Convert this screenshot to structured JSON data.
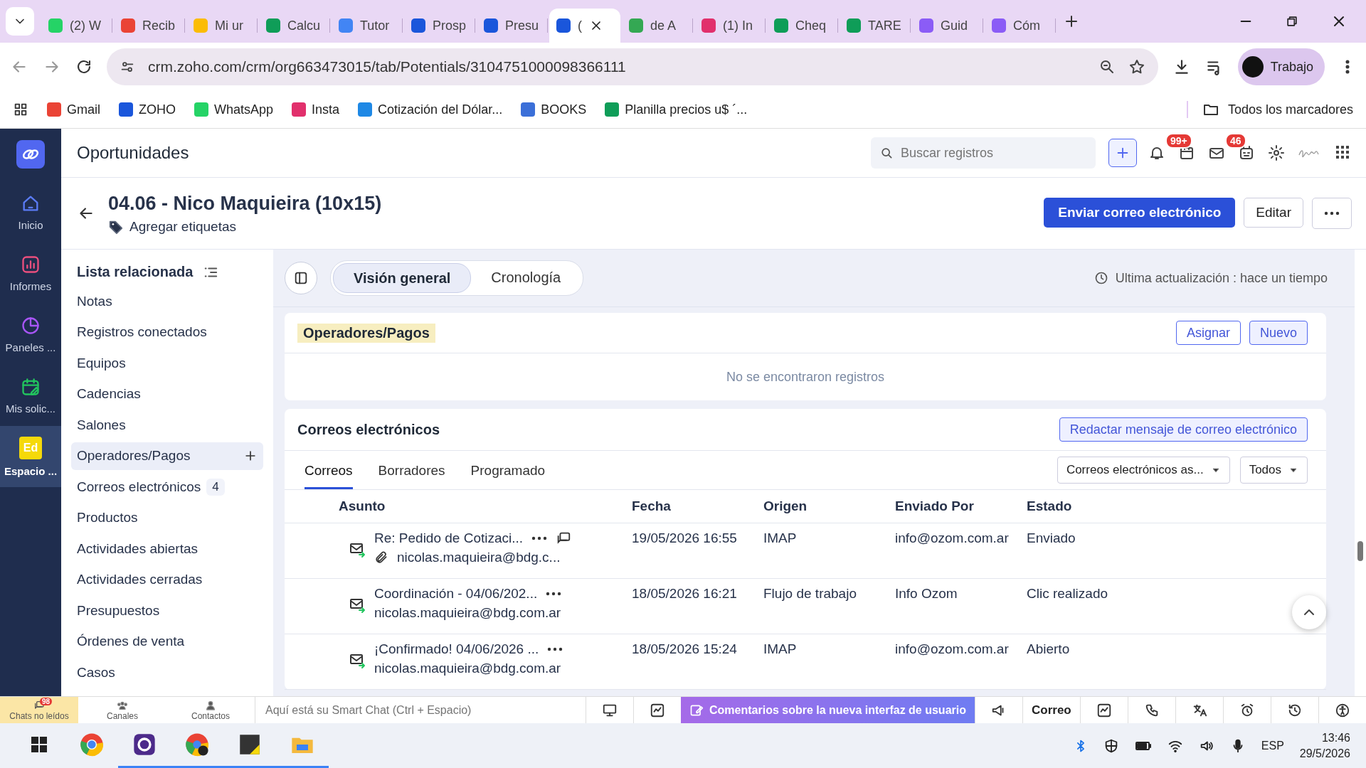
{
  "browser": {
    "tabs": [
      {
        "title": "(2) W",
        "color": "#25d366",
        "selected": false
      },
      {
        "title": "Recib",
        "color": "#ea4335",
        "selected": false
      },
      {
        "title": "Mi ur",
        "color": "#fbbc04",
        "selected": false
      },
      {
        "title": "Calcu",
        "color": "#0f9d58",
        "selected": false
      },
      {
        "title": "Tutor",
        "color": "#4285f4",
        "selected": false
      },
      {
        "title": "Prosp",
        "color": "#1a56db",
        "selected": false
      },
      {
        "title": "Presu",
        "color": "#1a56db",
        "selected": false
      },
      {
        "title": "(",
        "color": "#1a56db",
        "selected": true
      },
      {
        "title": "de A",
        "color": "#34a853",
        "selected": false
      },
      {
        "title": "(1) In",
        "color": "#e1306c",
        "selected": false
      },
      {
        "title": "Cheq",
        "color": "#0f9d58",
        "selected": false
      },
      {
        "title": "TARE",
        "color": "#0f9d58",
        "selected": false
      },
      {
        "title": "Guid",
        "color": "#8b5cf6",
        "selected": false
      },
      {
        "title": "Cóm",
        "color": "#8b5cf6",
        "selected": false
      }
    ],
    "url": "crm.zoho.com/crm/org663473015/tab/Potentials/3104751000098366111",
    "profile": "Trabajo",
    "bookmarks": [
      {
        "label": "Gmail",
        "color": "#ea4335"
      },
      {
        "label": "ZOHO",
        "color": "#1a56db"
      },
      {
        "label": "WhatsApp",
        "color": "#25d366"
      },
      {
        "label": "Insta",
        "color": "#e1306c"
      },
      {
        "label": "Cotización del Dólar...",
        "color": "#1e88e5"
      },
      {
        "label": "BOOKS",
        "color": "#3b6fd8"
      },
      {
        "label": "Planilla precios u$ ´...",
        "color": "#0f9d58"
      }
    ],
    "all_bookmarks": "Todos los marcadores"
  },
  "app_nav": [
    {
      "label": "Inicio",
      "color": "#5b7cf7",
      "selected": false
    },
    {
      "label": "Informes",
      "color": "#ec4f7e",
      "selected": false
    },
    {
      "label": "Paneles ...",
      "color": "#a855f7",
      "selected": false
    },
    {
      "label": "Mis solic...",
      "color": "#22c55e",
      "selected": false
    },
    {
      "label": "Espacio ...",
      "color": "#f5d90a",
      "badge": "Ed",
      "selected": true
    }
  ],
  "header": {
    "title": "Oportunidades",
    "search_placeholder": "Buscar registros",
    "notifications_badge": "99+",
    "mail_badge": "46"
  },
  "record": {
    "title": "04.06 - Nico Maquieira (10x15)",
    "tags_link": "Agregar etiquetas",
    "buttons": [
      "Enviar correo electrónico",
      "Editar"
    ]
  },
  "related_list": {
    "title": "Lista relacionada",
    "items": [
      {
        "label": "Notas",
        "selected": false
      },
      {
        "label": "Registros conectados",
        "selected": false
      },
      {
        "label": "Equipos",
        "selected": false
      },
      {
        "label": "Cadencias",
        "selected": false
      },
      {
        "label": "Salones",
        "selected": false
      },
      {
        "label": "Operadores/Pagos",
        "selected": true
      },
      {
        "label": "Correos electrónicos",
        "count": "4",
        "selected": false
      },
      {
        "label": "Productos",
        "selected": false
      },
      {
        "label": "Actividades abiertas",
        "selected": false
      },
      {
        "label": "Actividades cerradas",
        "selected": false
      },
      {
        "label": "Presupuestos",
        "selected": false
      },
      {
        "label": "Órdenes de venta",
        "selected": false
      },
      {
        "label": "Casos",
        "selected": false
      }
    ]
  },
  "view_tabs": [
    {
      "label": "Visión general",
      "selected": true
    },
    {
      "label": "Cronología",
      "selected": false
    }
  ],
  "last_update": "Ultima actualización : hace un tiempo",
  "operadores": {
    "title": "Operadores/Pagos",
    "buttons": [
      "Asignar",
      "Nuevo"
    ],
    "empty": "No se encontraron registros"
  },
  "emails": {
    "title": "Correos electrónicos",
    "compose": "Redactar mensaje de correo electrónico",
    "tabs": [
      {
        "label": "Correos",
        "selected": true
      },
      {
        "label": "Borradores",
        "selected": false
      },
      {
        "label": "Programado",
        "selected": false
      }
    ],
    "filters": [
      "Correos electrónicos as...",
      "Todos"
    ],
    "columns": [
      "Asunto",
      "Fecha",
      "Origen",
      "Enviado Por",
      "Estado"
    ],
    "rows": [
      {
        "subject": "Re: Pedido de Cotizaci...",
        "thread": true,
        "attachment": true,
        "to": "nicolas.maquieira@bdg.c...",
        "date": "19/05/2026 16:55",
        "origin": "IMAP",
        "sender": "info@ozom.com.ar",
        "status": "Enviado"
      },
      {
        "subject": "Coordinación - 04/06/202...",
        "thread": false,
        "attachment": false,
        "to": "nicolas.maquieira@bdg.com.ar",
        "date": "18/05/2026 16:21",
        "origin": "Flujo de trabajo",
        "sender": "Info Ozom",
        "status": "Clic realizado"
      },
      {
        "subject": "¡Confirmado! 04/06/2026 ...",
        "thread": false,
        "attachment": false,
        "to": "nicolas.maquieira@bdg.com.ar",
        "date": "18/05/2026 15:24",
        "origin": "IMAP",
        "sender": "info@ozom.com.ar",
        "status": "Abierto"
      }
    ]
  },
  "bottom_bar": {
    "chats": "Chats no leídos",
    "chats_badge": "98",
    "channels": "Canales",
    "contacts": "Contactos",
    "smart_chat_placeholder": "Aquí está su Smart Chat (Ctrl + Espacio)",
    "feedback": "Comentarios sobre la nueva interfaz de usuario",
    "mail": "Correo"
  },
  "taskbar": {
    "language": "ESP",
    "time": "13:46",
    "date": "29/5/2026"
  }
}
